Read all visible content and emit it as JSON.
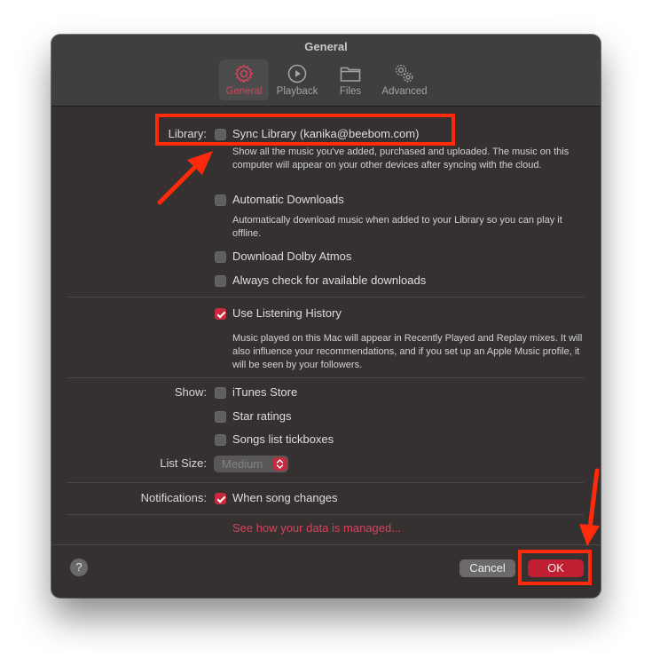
{
  "window": {
    "title": "General"
  },
  "toolbar": {
    "tabs": [
      {
        "label": "General",
        "icon": "gear-icon",
        "active": true
      },
      {
        "label": "Playback",
        "icon": "play-circle-icon",
        "active": false
      },
      {
        "label": "Files",
        "icon": "folder-icon",
        "active": false
      },
      {
        "label": "Advanced",
        "icon": "gears-icon",
        "active": false
      }
    ]
  },
  "library": {
    "label": "Library:",
    "sync": {
      "label": "Sync Library (kanika@beebom.com)",
      "checked": false
    },
    "sync_desc": "Show all the music you've added, purchased and uploaded. The music on this computer will appear on your other devices after syncing with the cloud.",
    "auto_downloads": {
      "label": "Automatic Downloads",
      "checked": false
    },
    "auto_downloads_desc": "Automatically download music when added to your Library so you can play it offline.",
    "dolby": {
      "label": "Download Dolby Atmos",
      "checked": false
    },
    "always_check": {
      "label": "Always check for available downloads",
      "checked": false
    }
  },
  "history": {
    "label": "Use Listening History",
    "checked": true,
    "desc": "Music played on this Mac will appear in Recently Played and Replay mixes. It will also influence your recommendations, and if you set up an Apple Music profile, it will be seen by your followers."
  },
  "show": {
    "label": "Show:",
    "items": [
      {
        "label": "iTunes Store",
        "checked": false
      },
      {
        "label": "Star ratings",
        "checked": false
      },
      {
        "label": "Songs list tickboxes",
        "checked": false
      }
    ]
  },
  "list_size": {
    "label": "List Size:",
    "value": "Medium"
  },
  "notifications": {
    "label": "Notifications:",
    "item": {
      "label": "When song changes",
      "checked": true
    }
  },
  "data_link": "See how your data is managed...",
  "footer": {
    "help": "?",
    "cancel": "Cancel",
    "ok": "OK"
  },
  "colors": {
    "accent": "#c52a3f",
    "link": "#d6435a",
    "annotation": "#ff2a0c"
  }
}
